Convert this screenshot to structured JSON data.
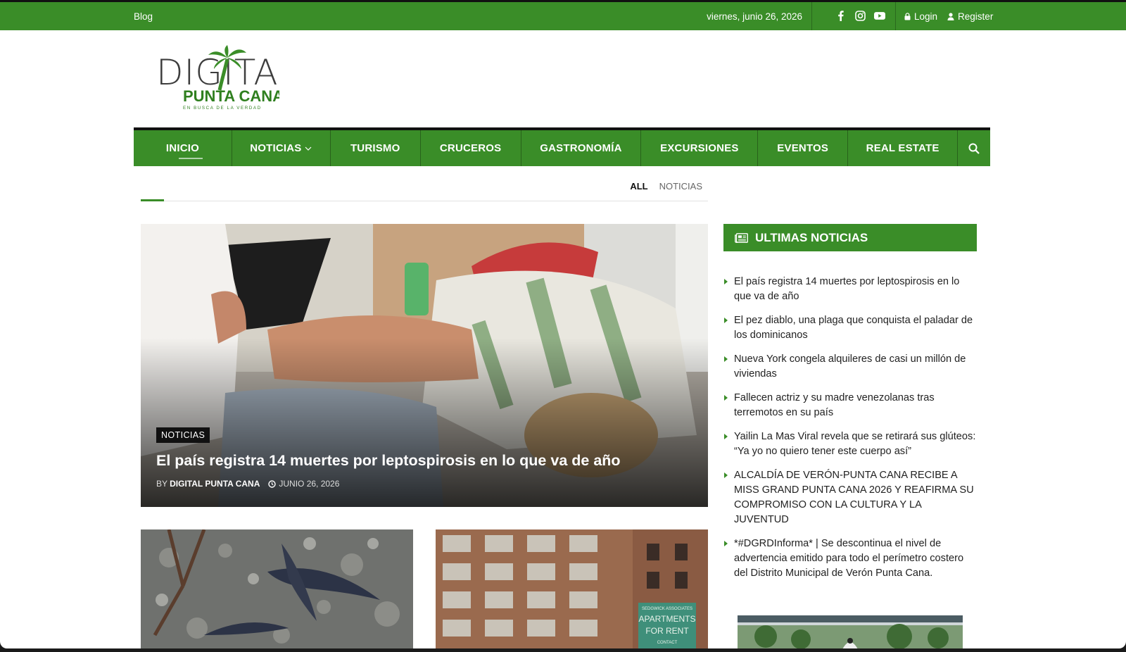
{
  "topbar": {
    "blog": "Blog",
    "date": "viernes, junio 26, 2026",
    "social": [
      "facebook-icon",
      "instagram-icon",
      "youtube-icon"
    ],
    "login": "Login",
    "register": "Register"
  },
  "logo": {
    "line1": "DIGITAL",
    "line2": "PUNTA CANA",
    "tagline": "EN BUSCA DE LA VERDAD"
  },
  "nav": {
    "items": [
      {
        "label": "INICIO"
      },
      {
        "label": "NOTICIAS"
      },
      {
        "label": "TURISMO"
      },
      {
        "label": "CRUCEROS"
      },
      {
        "label": "GASTRONOMÍA"
      },
      {
        "label": "EXCURSIONES"
      },
      {
        "label": "EVENTOS"
      },
      {
        "label": "REAL ESTATE"
      }
    ],
    "search_icon": "search-icon"
  },
  "filters": {
    "all": "ALL",
    "noticias": "NOTICIAS"
  },
  "hero": {
    "category": "NOTICIAS",
    "title": "El país registra 14 muertes por leptospirosis en lo que va de año",
    "by": "BY",
    "author": "DIGITAL PUNTA CANA",
    "date": "JUNIO 26, 2026"
  },
  "thumb2_sign": {
    "line1": "SEDGWICK ASSOCIATES",
    "line2": "APARTMENTS",
    "line3": "FOR RENT",
    "line4": "CONTACT"
  },
  "sidebar": {
    "heading": "ULTIMAS NOTICIAS",
    "items": [
      "El país registra 14 muertes por leptospirosis en lo que va de año",
      "El pez diablo, una plaga que conquista el paladar de los dominicanos",
      "Nueva York congela alquileres de casi un millón de viviendas",
      "Fallecen actriz y su madre venezolanas tras terremotos en su país",
      "Yailin La Mas Viral revela que se retirará sus glúteos: “Ya yo no quiero tener este cuerpo así”",
      "ALCALDÍA DE VERÓN-PUNTA CANA RECIBE A MISS GRAND PUNTA CANA 2026 Y REAFIRMA SU COMPROMISO CON LA CULTURA Y LA JUVENTUD",
      "*#DGRDInforma* | Se descontinua el nivel de advertencia emitido para todo el perímetro costero del Distrito Municipal de Verón Punta Cana."
    ]
  },
  "colors": {
    "brand_green": "#3a8d28",
    "dark": "#111111"
  }
}
